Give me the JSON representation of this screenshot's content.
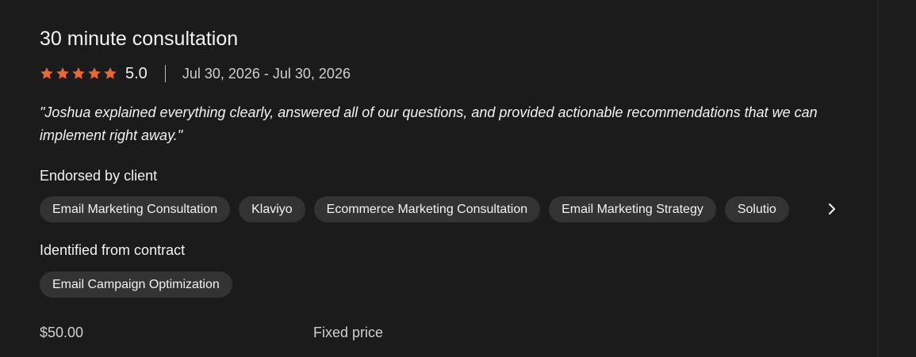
{
  "review": {
    "title": "30 minute consultation",
    "rating": "5.0",
    "stars": 5,
    "star_color": "#e8683a",
    "dates": "Jul 30, 2026 - Jul 30, 2026",
    "quote": "\"Joshua explained everything clearly, answered all of our questions, and provided actionable recommendations that we can implement right away.\""
  },
  "endorsed": {
    "label": "Endorsed by client",
    "skills": [
      "Email Marketing Consultation",
      "Klaviyo",
      "Ecommerce Marketing Consultation",
      "Email Marketing Strategy",
      "Solutio"
    ],
    "scroll_icon": "chevron-right-icon"
  },
  "identified": {
    "label": "Identified from contract",
    "skills": [
      "Email Campaign Optimization"
    ]
  },
  "pricing": {
    "amount": "$50.00",
    "type": "Fixed price"
  }
}
